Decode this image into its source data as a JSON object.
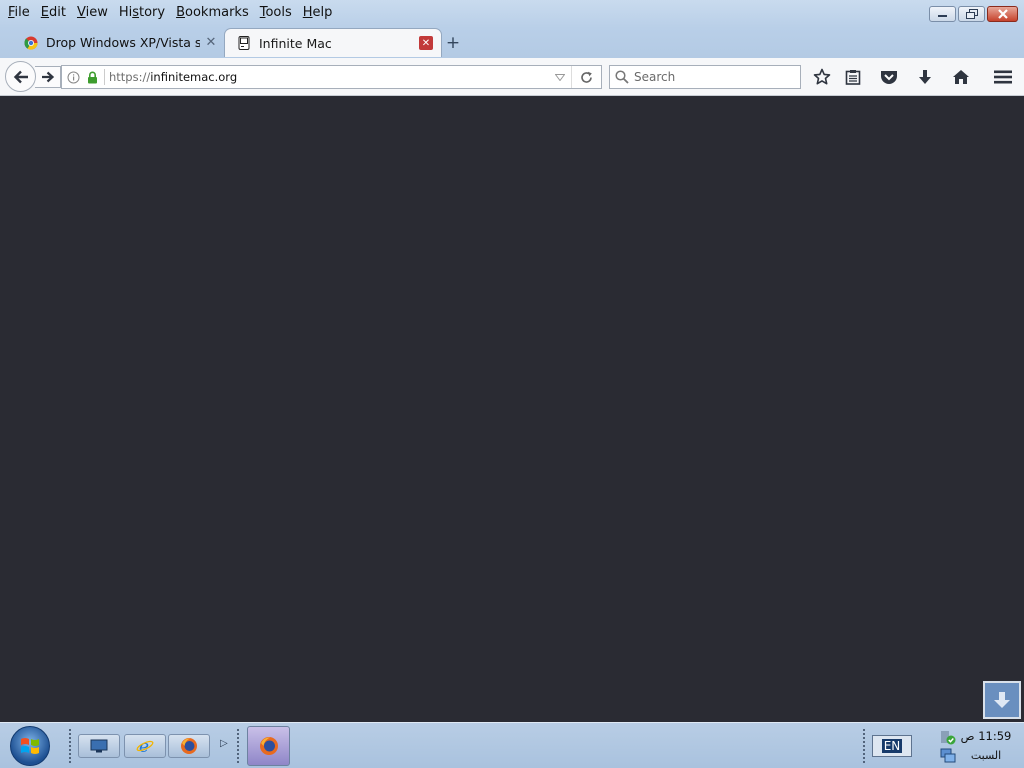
{
  "menu": {
    "items": [
      {
        "label": "File",
        "key": "F",
        "rest": "ile"
      },
      {
        "label": "Edit",
        "key": "E",
        "rest": "dit"
      },
      {
        "label": "View",
        "key": "V",
        "rest": "iew"
      },
      {
        "label": "History",
        "key": "s",
        "pre": "Hi",
        "rest": "tory"
      },
      {
        "label": "Bookmarks",
        "key": "B",
        "rest": "ookmarks"
      },
      {
        "label": "Tools",
        "key": "T",
        "rest": "ools"
      },
      {
        "label": "Help",
        "key": "H",
        "rest": "elp"
      }
    ]
  },
  "tabs": [
    {
      "title": "Drop Windows XP/Vista su...",
      "icon": "chrome-logo-icon",
      "active": false
    },
    {
      "title": "Infinite Mac",
      "icon": "classic-mac-icon",
      "active": true
    }
  ],
  "navbar": {
    "url_protocol": "https://",
    "url_host": "infinitemac.org",
    "search_placeholder": "Search"
  },
  "taskbar": {
    "language": "EN",
    "clock_time": "11:59 ص",
    "clock_day": "السبت"
  },
  "colors": {
    "content_bg": "#2a2b33",
    "chrome_bg": "#f6f7f9",
    "accent_blue": "#6a8fbf",
    "tab_close_red": "#c23a3a"
  }
}
